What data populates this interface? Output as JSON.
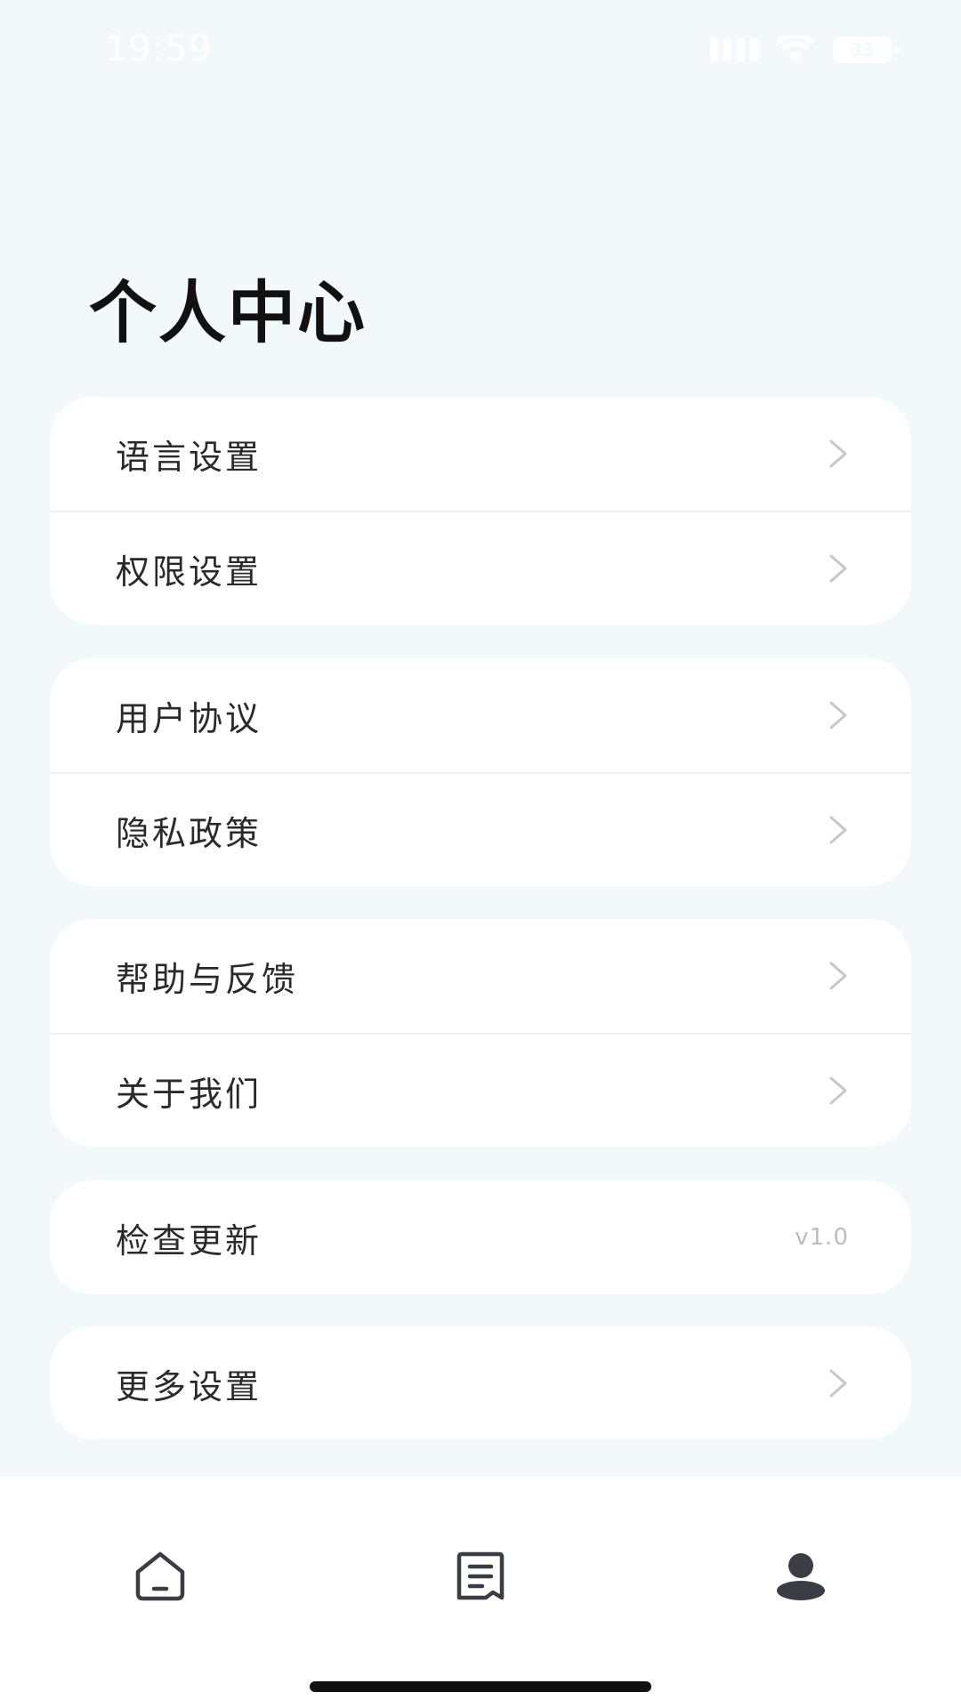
{
  "status_bar": {
    "time": "19:59",
    "battery": "33",
    "icons": [
      "signal-icon",
      "wifi-icon",
      "battery-icon"
    ]
  },
  "page": {
    "title": "个人中心"
  },
  "menu_groups": [
    {
      "items": [
        {
          "label": "语言设置",
          "icon": "chevron-right-icon"
        },
        {
          "label": "权限设置",
          "icon": "chevron-right-icon"
        }
      ]
    },
    {
      "items": [
        {
          "label": "用户协议",
          "icon": "chevron-right-icon"
        },
        {
          "label": "隐私政策",
          "icon": "chevron-right-icon"
        }
      ]
    },
    {
      "items": [
        {
          "label": "帮助与反馈",
          "icon": "chevron-right-icon"
        },
        {
          "label": "关于我们",
          "icon": "chevron-right-icon"
        }
      ]
    },
    {
      "items": [
        {
          "label": "检查更新",
          "value": "v1.0"
        }
      ]
    },
    {
      "items": [
        {
          "label": "更多设置",
          "icon": "chevron-right-icon"
        }
      ]
    }
  ],
  "bottom_nav": {
    "items": [
      {
        "icon": "home-icon",
        "active": false
      },
      {
        "icon": "document-icon",
        "active": false
      },
      {
        "icon": "profile-icon",
        "active": true
      }
    ]
  },
  "colors": {
    "background": "#f3f8fb",
    "card": "#ffffff",
    "title": "#111111",
    "label": "#2a2a2a",
    "chevron": "#c4c8cc",
    "version": "#b9bec4",
    "nav_icon": "#3a3d44"
  }
}
